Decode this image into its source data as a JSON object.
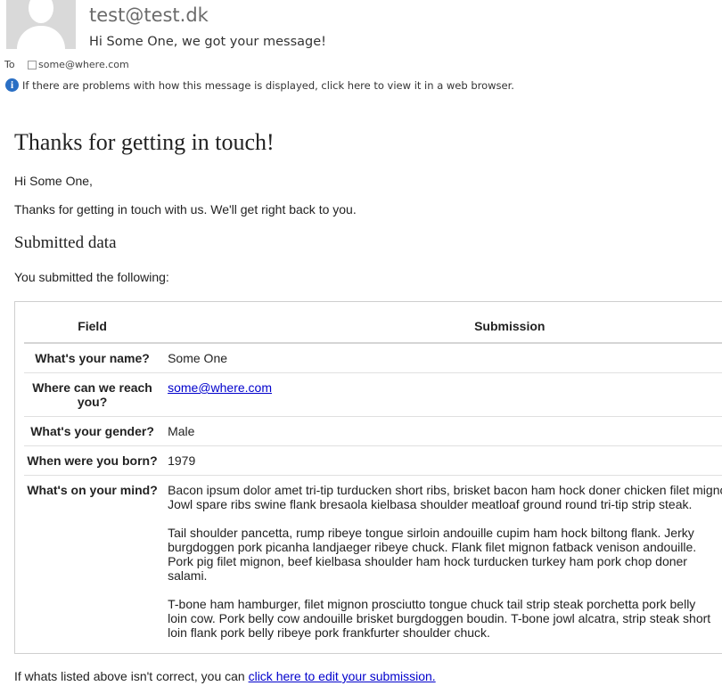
{
  "header": {
    "sender": "test@test.dk",
    "subject": "Hi Some One, we got your message!",
    "to_label": "To",
    "to_address": "some@where.com",
    "info_text": "If there are problems with how this message is displayed, click here to view it in a web browser."
  },
  "body": {
    "title": "Thanks for getting in touch!",
    "greeting": "Hi Some One,",
    "intro": "Thanks for getting in touch with us. We'll get right back to you.",
    "section_title": "Submitted data",
    "submitted_text": "You submitted the following:"
  },
  "table": {
    "headers": {
      "field": "Field",
      "submission": "Submission"
    },
    "rows": [
      {
        "field": "What's your name?",
        "value": "Some One"
      },
      {
        "field": "Where can we reach you?",
        "value": "some@where.com"
      },
      {
        "field": "What's your gender?",
        "value": "Male"
      },
      {
        "field": "When were you born?",
        "value": "1979"
      },
      {
        "field": "What's on your mind?",
        "paragraphs": [
          [
            "Bacon ipsum dolor amet tri-tip turducken short ribs, brisket bacon ham hock doner chicken filet mignon.",
            "Jowl spare ribs swine flank bresaola kielbasa shoulder meatloaf ground round tri-tip strip steak."
          ],
          [
            "Tail shoulder pancetta, rump ribeye tongue sirloin andouille cupim ham hock biltong flank. Jerky",
            "burgdoggen pork picanha landjaeger ribeye chuck. Flank filet mignon fatback venison andouille.",
            "Pork pig filet mignon, beef kielbasa shoulder ham hock turducken turkey ham pork chop doner",
            "salami."
          ],
          [
            "T-bone ham hamburger, filet mignon prosciutto tongue chuck tail strip steak porchetta pork belly",
            "loin cow. Pork belly cow andouille brisket burgdoggen boudin. T-bone jowl alcatra, strip steak short",
            "loin flank pork belly ribeye pork frankfurter shoulder chuck."
          ]
        ]
      }
    ]
  },
  "footer": {
    "text": "If whats listed above isn't correct, you can ",
    "link": "click here to edit your submission."
  },
  "colors": {
    "link": "#0000cc",
    "info_icon": "#2a6fc4"
  }
}
